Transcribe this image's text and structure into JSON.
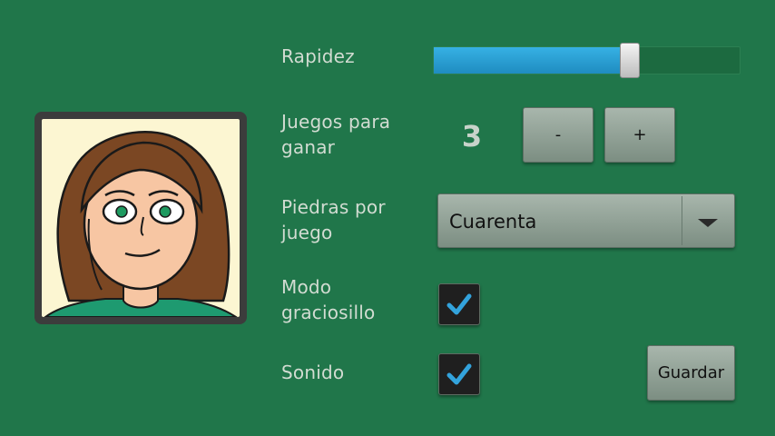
{
  "avatar": {
    "icon": "girl-avatar-icon"
  },
  "speed": {
    "label": "Rapidez",
    "value_fraction": 0.64,
    "accent": "#2ba6dc"
  },
  "games_to_win": {
    "label_line1": "Juegos para",
    "label_line2": "ganar",
    "value": "3",
    "decrement_label": "-",
    "increment_label": "+"
  },
  "stones_per_game": {
    "label_line1": "Piedras por",
    "label_line2": "juego",
    "selected": "Cuarenta"
  },
  "funny_mode": {
    "label_line1": "Modo",
    "label_line2": "graciosillo",
    "checked": true
  },
  "sound": {
    "label": "Sonido",
    "checked": true
  },
  "save_button": {
    "label": "Guardar"
  }
}
